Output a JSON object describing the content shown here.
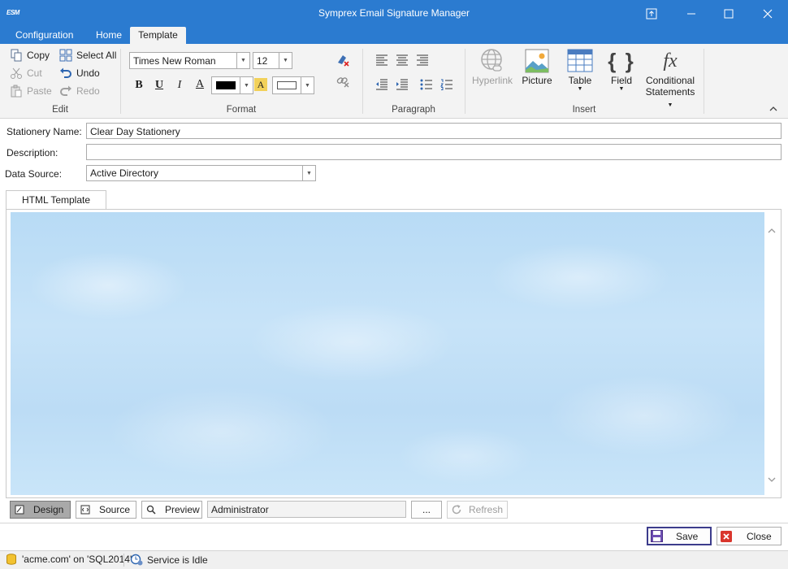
{
  "window": {
    "title": "Symprex Email Signature Manager",
    "app_icon_text": "ESM"
  },
  "ribbon_tabs": [
    "Configuration",
    "Home",
    "Template"
  ],
  "ribbon": {
    "edit": {
      "label": "Edit",
      "copy": "Copy",
      "cut": "Cut",
      "paste": "Paste",
      "select_all": "Select All",
      "undo": "Undo",
      "redo": "Redo"
    },
    "format": {
      "label": "Format",
      "font_name": "Times New Roman",
      "font_size": "12",
      "bold": "B",
      "underline": "U",
      "italic": "I",
      "font_color_glyph": "A",
      "highlight_glyph": "A"
    },
    "paragraph": {
      "label": "Paragraph"
    },
    "insert": {
      "label": "Insert",
      "hyperlink": "Hyperlink",
      "picture": "Picture",
      "table": "Table",
      "field": "Field",
      "conditional_line1": "Conditional",
      "conditional_line2": "Statements",
      "field_glyph": "{ }",
      "fx_glyph": "fx"
    }
  },
  "form": {
    "stationery_name_label": "Stationery Name:",
    "stationery_name_value": "Clear Day Stationery",
    "description_label": "Description:",
    "description_value": "",
    "data_source_label": "Data Source:",
    "data_source_value": "Active Directory"
  },
  "editor_tab": "HTML Template",
  "view_buttons": {
    "design": "Design",
    "source": "Source",
    "preview": "Preview",
    "preview_user": "Administrator",
    "browse": "...",
    "refresh": "Refresh"
  },
  "dialog_buttons": {
    "save": "Save",
    "close": "Close"
  },
  "status": {
    "connection": "'acme.com' on 'SQL2014'",
    "service": "Service is Idle"
  },
  "colors": {
    "titlebar": "#2b7bd0",
    "ribbon_bg": "#f3f3f3",
    "editor_background": "#c1dff7"
  }
}
